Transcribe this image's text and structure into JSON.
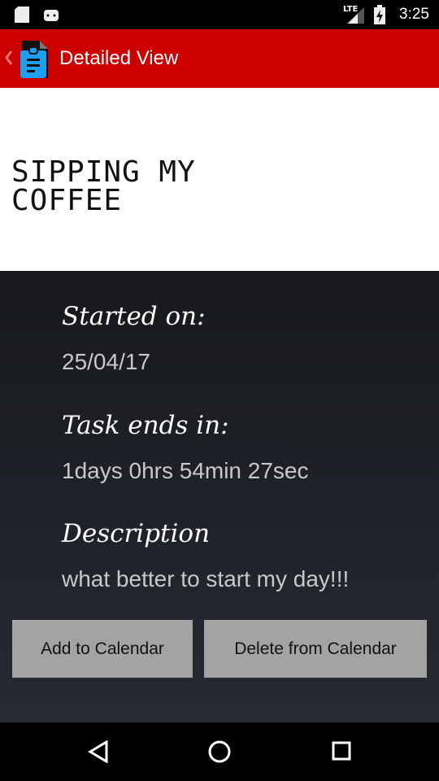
{
  "status": {
    "time": "3:25",
    "network": "LTE"
  },
  "appbar": {
    "title": "Detailed View"
  },
  "task": {
    "name": "SIPPING MY COFFEE"
  },
  "details": {
    "started_label": "Started on:",
    "started_value": "25/04/17",
    "ends_label": "Task ends in:",
    "ends_value": "1days 0hrs 54min 27sec",
    "desc_label": "Description",
    "desc_value": "what better to start my day!!!"
  },
  "buttons": {
    "add": "Add to Calendar",
    "delete": "Delete from Calendar"
  }
}
